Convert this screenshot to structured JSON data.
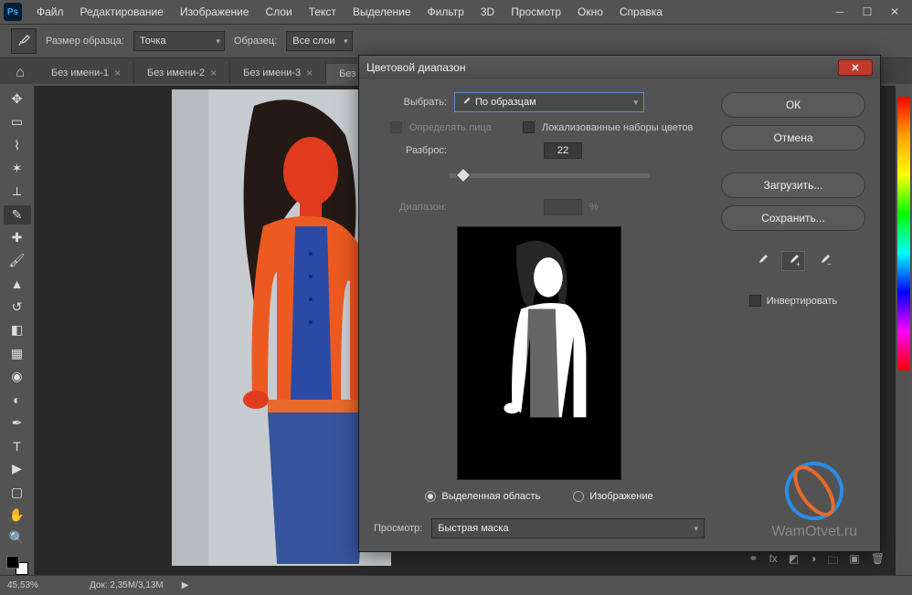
{
  "menubar": {
    "items": [
      "Файл",
      "Редактирование",
      "Изображение",
      "Слои",
      "Текст",
      "Выделение",
      "Фильтр",
      "3D",
      "Просмотр",
      "Окно",
      "Справка"
    ]
  },
  "optionbar": {
    "sample_size_label": "Размер образца:",
    "sample_size_value": "Точка",
    "sample_label": "Образец:",
    "sample_value": "Все слои"
  },
  "tabs": {
    "items": [
      {
        "label": "Без имени-1"
      },
      {
        "label": "Без имени-2"
      },
      {
        "label": "Без имени-3"
      },
      {
        "label": "Без и"
      }
    ]
  },
  "status": {
    "zoom": "45,53%",
    "doc": "Док: 2,35M/3,13M"
  },
  "dialog": {
    "title": "Цветовой диапазон",
    "select_label": "Выбрать:",
    "select_value": "По образцам",
    "detect_faces": "Определять лица",
    "localized": "Локализованные наборы цветов",
    "fuzziness_label": "Разброс:",
    "fuzziness_value": "22",
    "range_label": "Диапазон:",
    "range_unit": "%",
    "radio_selection": "Выделенная область",
    "radio_image": "Изображение",
    "preview_label": "Просмотр:",
    "preview_value": "Быстрая маска",
    "ok": "ОК",
    "cancel": "Отмена",
    "load": "Загрузить...",
    "save": "Сохранить...",
    "invert": "Инвертировать"
  },
  "watermark": "WamOtvet.ru"
}
